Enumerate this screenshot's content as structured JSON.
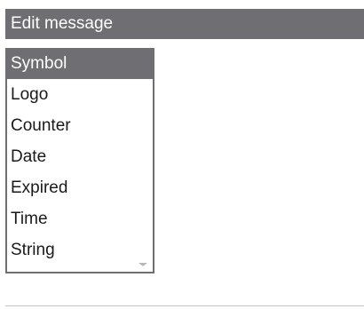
{
  "dialog": {
    "title": "Edit message"
  },
  "list": {
    "selected_index": 0,
    "items": [
      {
        "label": "Symbol"
      },
      {
        "label": "Logo"
      },
      {
        "label": "Counter"
      },
      {
        "label": "Date"
      },
      {
        "label": "Expired"
      },
      {
        "label": "Time"
      },
      {
        "label": "String"
      }
    ],
    "scroll_icon": "chevron-down-icon"
  },
  "colors": {
    "title_bar": "#6f6e72",
    "selection": "#6f6e72",
    "text": "#1a1a1a",
    "background": "#ffffff"
  }
}
